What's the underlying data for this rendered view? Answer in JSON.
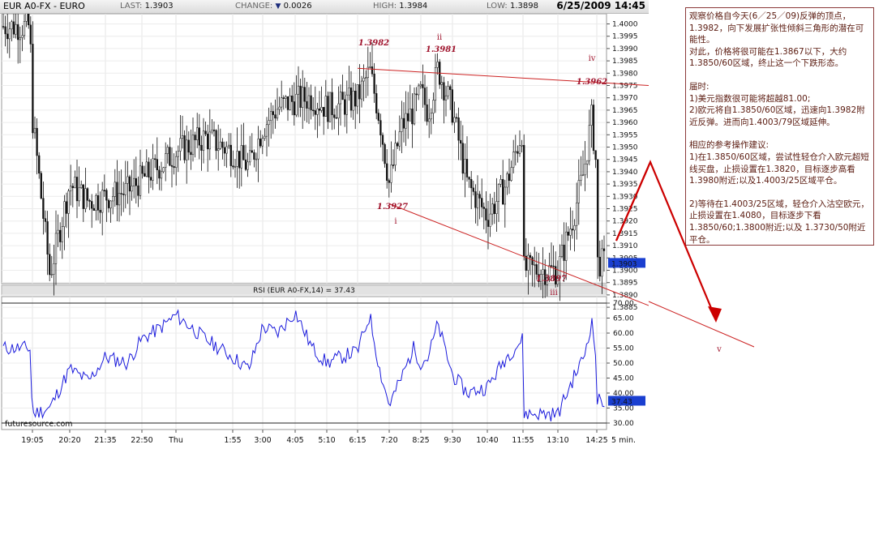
{
  "header": {
    "symbol": "EUR A0-FX - EURO",
    "last_label": "LAST:",
    "last_value": "1.3903",
    "change_label": "CHANGE:",
    "change_value": "0.0026",
    "high_label": "HIGH:",
    "high_value": "1.3984",
    "low_label": "LOW:",
    "low_value": "1.3898",
    "datetime": "6/25/2009 14:45"
  },
  "rsi_title": "RSI (EUR A0-FX,14) = 37.43",
  "watermark": "futuresource.com",
  "interval": "5 min.",
  "price_badge": "1.3903",
  "rsi_badge": "37.43",
  "note": {
    "p1": "观察价格自今天(6／25／09)反弹的顶点，1.3982，向下发展扩张性倾斜三角形的潜在可能性。",
    "p2": "对此，价格将很可能在1.3867以下，大约1.3850/60区域，终止这一个下跌形态。",
    "p3_title": "届时:",
    "p3_line1": "1)美元指数很可能将超越81.00;",
    "p3_line2": "2)欧元将自1.3850/60区域，迅速向1.3982附近反弹。进而向1.4003/79区域延伸。",
    "p4_title": "相应的参考操作建议:",
    "p4_line1": "1)在1.3850/60区域，尝试性轻仓介入欧元超短线买盘，止损设置在1.3820，目标逐步高看1.3980附近;以及1.4003/25区域平仓。",
    "p4_line2": "2)等待在1.4003/25区域，轻仓介入沽空欧元，止损设置在1.4080，目标逐步下看1.3850/60;1.3800附近;以及 1.3730/50附近平仓。"
  },
  "annotations": {
    "wave_labels": [
      "i",
      "ii",
      "iii",
      "iv",
      "v"
    ],
    "price_labels": [
      "1.3982",
      "1.3981",
      "1.3927",
      "1.3897",
      "1.3962"
    ]
  },
  "colors": {
    "candle": "#111111",
    "rsi_line": "#1a1adc",
    "trendline": "#cc2222",
    "arrow": "#cc0000",
    "badge": "#1a3fd0",
    "annotation": "#a0142d"
  },
  "chart_data": [
    {
      "type": "candlestick",
      "title": "EUR A0-FX - EURO",
      "interval": "5 min.",
      "x_tick_labels": [
        "19:05",
        "20:20",
        "21:35",
        "22:50",
        "Thu",
        "1:55",
        "3:00",
        "4:05",
        "5:10",
        "6:15",
        "7:20",
        "8:25",
        "9:30",
        "10:40",
        "11:55",
        "13:10",
        "14:25"
      ],
      "y_tick_labels": [
        "1.4000",
        "1.3995",
        "1.3990",
        "1.3985",
        "1.3980",
        "1.3975",
        "1.3970",
        "1.3965",
        "1.3960",
        "1.3955",
        "1.3950",
        "1.3945",
        "1.3940",
        "1.3935",
        "1.3930",
        "1.3925",
        "1.3920",
        "1.3915",
        "1.3910",
        "1.3905",
        "1.3900",
        "1.3895",
        "1.3890",
        "1.3885"
      ],
      "ylim": [
        1.3883,
        1.4003
      ],
      "close_path_x": [
        "19:00",
        "19:05",
        "19:40",
        "20:20",
        "21:00",
        "21:35",
        "22:20",
        "22:50",
        "23:30",
        "Thu",
        "1:00",
        "1:55",
        "2:30",
        "3:00",
        "3:30",
        "4:05",
        "4:40",
        "5:10",
        "5:40",
        "6:15",
        "6:40",
        "7:00",
        "7:20",
        "7:45",
        "8:10",
        "8:25",
        "8:40",
        "9:00",
        "9:30",
        "10:00",
        "10:40",
        "11:20",
        "11:55",
        "12:20",
        "12:50",
        "13:10",
        "13:40",
        "14:00",
        "14:15",
        "14:25",
        "14:40"
      ],
      "close_path_y": [
        1.3999,
        1.3962,
        1.3898,
        1.3935,
        1.3928,
        1.393,
        1.3932,
        1.3937,
        1.3943,
        1.3948,
        1.3954,
        1.3948,
        1.3942,
        1.3958,
        1.3966,
        1.3969,
        1.397,
        1.3966,
        1.3967,
        1.397,
        1.3981,
        1.3962,
        1.3935,
        1.3958,
        1.3965,
        1.3972,
        1.3964,
        1.3982,
        1.3965,
        1.3935,
        1.3922,
        1.3935,
        1.3958,
        1.3925,
        1.3905,
        1.39,
        1.3922,
        1.394,
        1.3962,
        1.394,
        1.3903
      ],
      "pivots": [
        {
          "label": "ii",
          "time": "6:15",
          "price": 1.3982
        },
        {
          "label": "i",
          "time": "7:20",
          "price": 1.3927
        },
        {
          "label": "ii",
          "time": "9:00",
          "price": 1.3981
        },
        {
          "label": "iii",
          "time": "13:10",
          "price": 1.3897
        },
        {
          "label": "iv",
          "time": "14:15",
          "price": 1.3962
        }
      ],
      "last_price": 1.3903
    },
    {
      "type": "line",
      "title": "RSI (EUR A0-FX,14) = 37.43",
      "y_tick_labels": [
        "70.00",
        "65.00",
        "60.00",
        "55.00",
        "50.00",
        "45.00",
        "40.00",
        "35.00",
        "30.00"
      ],
      "ylim": [
        28,
        72
      ],
      "x": [
        "19:00",
        "19:05",
        "19:40",
        "20:20",
        "21:00",
        "21:35",
        "22:20",
        "22:50",
        "23:30",
        "Thu",
        "1:00",
        "1:55",
        "2:30",
        "3:00",
        "3:30",
        "4:05",
        "4:40",
        "5:10",
        "5:40",
        "6:15",
        "6:40",
        "7:00",
        "7:20",
        "7:45",
        "8:10",
        "8:25",
        "8:40",
        "9:00",
        "9:30",
        "10:00",
        "10:40",
        "11:20",
        "11:55",
        "12:20",
        "12:50",
        "13:10",
        "13:40",
        "14:00",
        "14:15",
        "14:25",
        "14:40"
      ],
      "values": [
        55,
        33,
        35,
        48,
        44,
        52,
        50,
        58,
        62,
        66,
        58,
        52,
        48,
        62,
        60,
        67,
        55,
        50,
        52,
        54,
        66,
        48,
        36,
        45,
        55,
        50,
        52,
        63,
        46,
        40,
        42,
        52,
        58,
        42,
        37,
        33,
        45,
        52,
        64,
        50,
        37.43
      ],
      "last_value": 37.43
    }
  ]
}
